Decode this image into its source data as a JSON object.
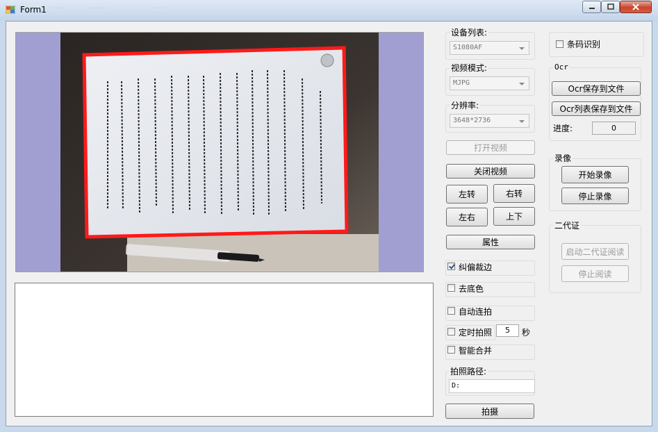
{
  "window": {
    "title": "Form1",
    "ghost_texts": [
      "·· ····",
      "········",
      "·····"
    ]
  },
  "camera": {
    "device_label": "设备列表:",
    "device_value": "S1080AF",
    "mode_label": "视频模式:",
    "mode_value": "MJPG",
    "resolution_label": "分辨率:",
    "resolution_value": "3648*2736"
  },
  "buttons": {
    "open_video": "打开视频",
    "close_video": "关闭视频",
    "rotate_left": "左转",
    "rotate_right": "右转",
    "flip_lr": "左右",
    "flip_ud": "上下",
    "properties": "属性",
    "capture": "拍摄"
  },
  "options": {
    "deskew_crop": "纠偏裁边",
    "remove_bg": "去底色",
    "auto_capture": "自动连拍",
    "timed_capture": "定时拍照",
    "timer_value": "5",
    "timer_unit": "秒",
    "smart_merge": "智能合并",
    "path_label": "拍照路径:",
    "path_value": "D:"
  },
  "barcode": {
    "label": "条码识别"
  },
  "ocr": {
    "group": "Ocr",
    "save_file": "Ocr保存到文件",
    "save_list": "Ocr列表保存到文件",
    "progress_label": "进度:",
    "progress_value": "0"
  },
  "recording": {
    "group": "录像",
    "start": "开始录像",
    "stop": "停止录像"
  },
  "idcard": {
    "group": "二代证",
    "start": "启动二代证阅读",
    "stop": "停止阅读"
  },
  "colors": {
    "preview_bg": "#a19fd2",
    "crop_frame": "#ff1a1a"
  }
}
